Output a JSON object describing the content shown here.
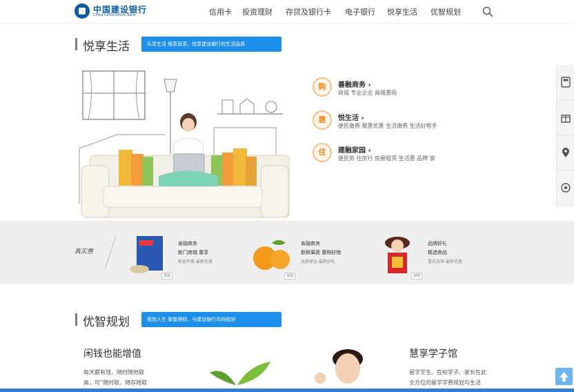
{
  "header": {
    "logo_cn": "中国建设银行",
    "logo_en": "China Construction Bank",
    "nav": [
      {
        "label": "信用卡"
      },
      {
        "label": "投资理财"
      },
      {
        "label": "存贷及银行卡"
      },
      {
        "label": "电子银行"
      },
      {
        "label": "悦享生活"
      },
      {
        "label": "优智规划"
      }
    ]
  },
  "section1": {
    "title": "悦享生活",
    "tag": "乐享生活 惬意而享，悦享建设银行的生活品质"
  },
  "features": [
    {
      "icon": "购",
      "title": "善融商务 ›",
      "desc": "商城 专业企业 商城惠购"
    },
    {
      "icon": "惠",
      "title": "悦生活 ›",
      "desc": "便民缴费 聚惠优惠 生活缴费 生活好帮手"
    },
    {
      "icon": "住",
      "title": "建融家园 ›",
      "desc": "便民房 住房行 房屋租赁 生活惠 品牌 家"
    }
  ],
  "strip": {
    "label": "真实惠",
    "products": [
      {
        "t1": "善融商务",
        "t2": "新门商城 惠享",
        "t3": "新品件惠 最新优惠",
        "badge": "详情"
      },
      {
        "t1": "善融商务",
        "t2": "新鲜果蔬 惠购好物",
        "t3": "品质保证 最新好礼",
        "badge": "详情"
      },
      {
        "t1": "品牌好礼",
        "t2": "精选商品",
        "t3": "喜庆吉祥 最新优惠",
        "badge": "详情"
      }
    ]
  },
  "section2": {
    "title": "优智规划",
    "tag": "规划人生 智能理财，与建设银行共同规划",
    "left_title": "闲钱也能增值",
    "left_lines": [
      "每天都有钱，随时随地取",
      "高，可“随时取，随存随取"
    ],
    "right_title": "慧享学子馆",
    "right_lines": [
      "留学学生、在校学子、家长在此",
      "全方位的留学学费规划与生活"
    ]
  },
  "colors": {
    "brand": "#0a5ca8",
    "accent": "#1d8eea",
    "feature_icon": "#f08a24"
  }
}
